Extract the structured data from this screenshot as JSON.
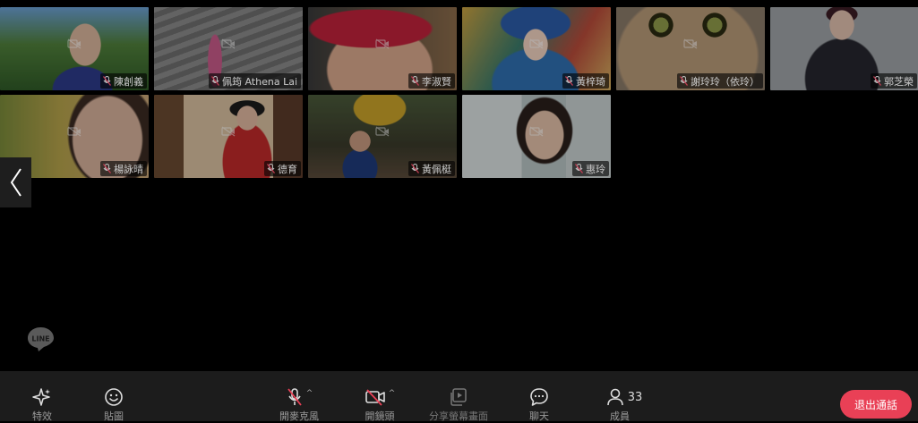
{
  "participants": [
    {
      "name": "陳創義",
      "palette": "forest-elder"
    },
    {
      "name": "佩筠 Athena Lai",
      "palette": "stairs"
    },
    {
      "name": "李淑賢",
      "palette": "red-cap"
    },
    {
      "name": "黃梓琦",
      "palette": "opera"
    },
    {
      "name": "謝玲玲（依玲）",
      "palette": "cat"
    },
    {
      "name": "郭芝榮",
      "palette": "suit"
    },
    {
      "name": "楊詠晴",
      "palette": "woman-leaves"
    },
    {
      "name": "德育",
      "palette": "red-dress"
    },
    {
      "name": "黃佩梃",
      "palette": "garden"
    },
    {
      "name": "惠玲",
      "palette": "bookshelf"
    }
  ],
  "logo_text": "LINE",
  "toolbar": {
    "effects": "特效",
    "stickers": "貼圖",
    "mic": "開麥克風",
    "camera": "開鏡頭",
    "share": "分享螢幕畫面",
    "chat": "聊天",
    "members": "成員",
    "member_count": "33",
    "leave": "退出通話"
  },
  "colors": {
    "leave_button": "#e94056",
    "toolbar_bg": "#1c1c1c",
    "muted_red": "#e94056"
  }
}
